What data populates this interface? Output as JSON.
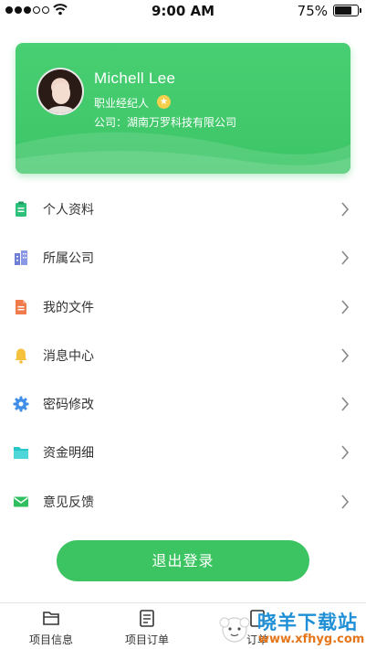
{
  "status_bar": {
    "time": "9:00 AM",
    "battery_percent": "75%",
    "battery_level": 0.75
  },
  "profile": {
    "name": "Michell Lee",
    "role": "职业经纪人",
    "company": "公司：湖南万罗科技有限公司"
  },
  "menu": {
    "items": [
      {
        "label": "个人资料",
        "icon": "clipboard-icon",
        "color": "#2cc07a"
      },
      {
        "label": "所属公司",
        "icon": "building-icon",
        "color": "#6f7fd6"
      },
      {
        "label": "我的文件",
        "icon": "file-icon",
        "color": "#f07b4d"
      },
      {
        "label": "消息中心",
        "icon": "bell-icon",
        "color": "#f6c23e"
      },
      {
        "label": "密码修改",
        "icon": "gear-icon",
        "color": "#3f8ee8"
      },
      {
        "label": "资金明细",
        "icon": "folder-icon",
        "color": "#27c6c9"
      },
      {
        "label": "意见反馈",
        "icon": "mail-icon",
        "color": "#2fbf5f"
      }
    ]
  },
  "logout_label": "退出登录",
  "tabbar": {
    "tabs": [
      {
        "label": "项目信息",
        "icon": "folder-tab-icon"
      },
      {
        "label": "项目订单",
        "icon": "list-tab-icon"
      },
      {
        "label": "订单",
        "icon": "order-tab-icon"
      }
    ]
  },
  "watermark": {
    "text": "晓羊下载站",
    "url": "www.xfhyg.com"
  },
  "colors": {
    "accent": "#3dc462"
  }
}
